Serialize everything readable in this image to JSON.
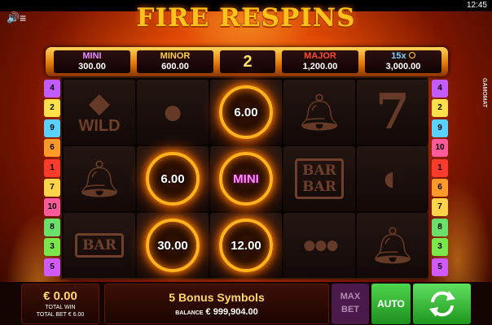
{
  "status": {
    "time": "12:45"
  },
  "header": {
    "title": "FIRE RESPINS",
    "provider": "GAMOMAT"
  },
  "jackpots": [
    {
      "name": "MINI",
      "value": "300.00",
      "color": "#e88cff"
    },
    {
      "name": "MINOR",
      "value": "600.00",
      "color": "#ffcf47"
    },
    {
      "name": "MAJOR",
      "value": "1,200.00",
      "color": "#ff4a2e"
    },
    {
      "name": "15x",
      "value": "3,000.00",
      "color": "#7ad0ff"
    }
  ],
  "respins_left": "2",
  "paylines": {
    "left": [
      {
        "n": "4",
        "color": "#c25cff"
      },
      {
        "n": "2",
        "color": "#ffe04a"
      },
      {
        "n": "9",
        "color": "#5ad1ff"
      },
      {
        "n": "6",
        "color": "#ff9a2a"
      },
      {
        "n": "1",
        "color": "#ff3b2b"
      },
      {
        "n": "7",
        "color": "#ffd34a"
      },
      {
        "n": "10",
        "color": "#ff5a9a"
      },
      {
        "n": "8",
        "color": "#6ae06a"
      },
      {
        "n": "3",
        "color": "#7ae84a"
      },
      {
        "n": "5",
        "color": "#d05aff"
      }
    ],
    "right": [
      {
        "n": "4",
        "color": "#c25cff"
      },
      {
        "n": "2",
        "color": "#ffe04a"
      },
      {
        "n": "9",
        "color": "#5ad1ff"
      },
      {
        "n": "10",
        "color": "#ff5a9a"
      },
      {
        "n": "1",
        "color": "#ff3b2b"
      },
      {
        "n": "6",
        "color": "#ff9a2a"
      },
      {
        "n": "7",
        "color": "#ffd34a"
      },
      {
        "n": "8",
        "color": "#6ae06a"
      },
      {
        "n": "3",
        "color": "#7ae84a"
      },
      {
        "n": "5",
        "color": "#d05aff"
      }
    ]
  },
  "reels": {
    "r0c2": "6.00",
    "r1c1": "6.00",
    "r1c2": "MINI",
    "r2c1": "30.00",
    "r2c2": "12.00",
    "bar_label": "BAR",
    "wild_label": "WILD",
    "seven": "7"
  },
  "footer": {
    "total_win_amount": "€ 0.00",
    "total_win_label": "TOTAL WIN",
    "total_bet": "TOTAL BET € 6.00",
    "message": "5 Bonus Symbols",
    "balance_label": "BALANCE",
    "balance_value": "€ 999,904.00",
    "max_bet_label_1": "MAX",
    "max_bet_label_2": "BET",
    "auto_label": "AUTO"
  }
}
